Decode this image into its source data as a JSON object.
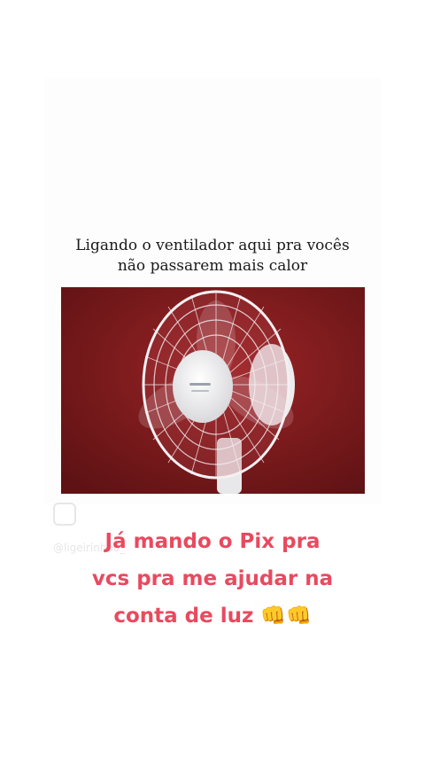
{
  "meme": {
    "caption_line1": "Ligando o ventilador aqui pra vocês",
    "caption_line2": "não passarem mais calor"
  },
  "watermark": {
    "handle": "@ligeirinhoo_"
  },
  "overlay": {
    "line1": "Já mando o Pix pra",
    "line2": "vcs pra me ajudar na",
    "line3": "conta de luz 👊👊"
  },
  "colors": {
    "overlay_text": "#e84a5f",
    "photo_background": "#7a1a1c"
  }
}
